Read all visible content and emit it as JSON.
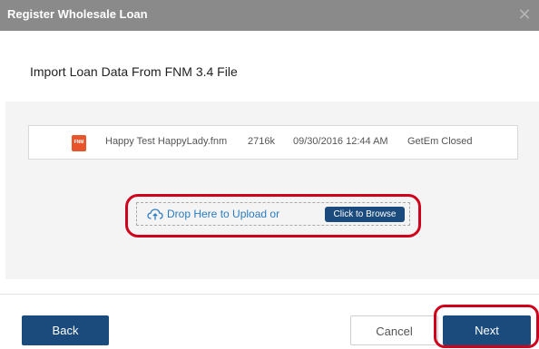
{
  "window": {
    "title": "Register Wholesale Loan",
    "close_glyph": "✕"
  },
  "main": {
    "heading": "Import Loan Data From FNM 3.4 File"
  },
  "file": {
    "icon_label": "FNM",
    "name": "Happy Test HappyLady.fnm",
    "size": "2716k",
    "datetime": "09/30/2016 12:44 AM",
    "status": "GetEm Closed"
  },
  "upload": {
    "drop_text": "Drop Here to Upload or",
    "browse_label": "Click to Browse"
  },
  "footer": {
    "back_label": "Back",
    "cancel_label": "Cancel",
    "next_label": "Next"
  },
  "colors": {
    "primary": "#1b4a7c",
    "titlebar": "#8a8a8a",
    "highlight": "#d0021b",
    "file_icon": "#e8542b",
    "link": "#2a7bc0"
  }
}
